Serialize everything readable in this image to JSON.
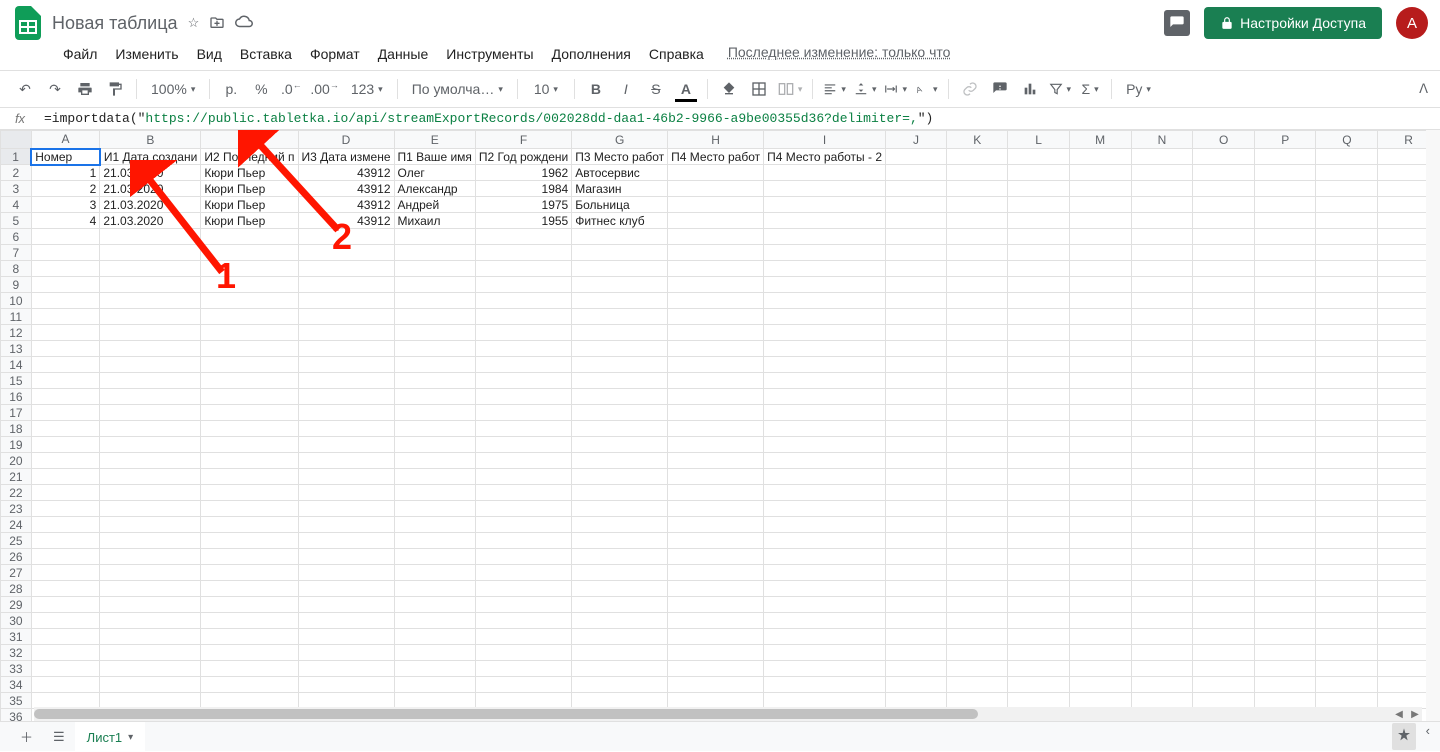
{
  "doc_title": "Новая таблица",
  "menu": [
    "Файл",
    "Изменить",
    "Вид",
    "Вставка",
    "Формат",
    "Данные",
    "Инструменты",
    "Дополнения",
    "Справка"
  ],
  "last_edit": "Последнее изменение: только что",
  "share_label": "Настройки Доступа",
  "avatar_letter": "А",
  "toolbar": {
    "zoom": "100%",
    "currency_p": "р.",
    "percent": "%",
    "dec_minus": ".0",
    "dec_plus": ".00",
    "more_fmt": "123",
    "font_name": "По умолча…",
    "font_size": "10"
  },
  "formula": {
    "prefix": "=importdata(\"",
    "url": "https://public.tabletka.io/api/streamExportRecords/002028dd-daa1-46b2-9966-a9be00355d36?delimiter=,",
    "suffix": "\")"
  },
  "columns": [
    "A",
    "B",
    "C",
    "D",
    "E",
    "F",
    "G",
    "H",
    "I",
    "J",
    "K",
    "L",
    "M",
    "N",
    "O",
    "P",
    "Q",
    "R"
  ],
  "headers_row": [
    "Номер",
    "И1 Дата создани",
    "И2 Последний п",
    "И3 Дата измене",
    "П1 Ваше имя",
    "П2 Год рождени",
    "П3 Место работ",
    "П4 Место работ",
    "П4 Место работы - 2"
  ],
  "data": [
    [
      "1",
      "21.03.2020",
      "Кюри Пьер",
      "43912",
      "Олег",
      "1962",
      "Автосервис",
      "",
      ""
    ],
    [
      "2",
      "21.03.2020",
      "Кюри Пьер",
      "43912",
      "Александр",
      "1984",
      "Магазин",
      "",
      ""
    ],
    [
      "3",
      "21.03.2020",
      "Кюри Пьер",
      "43912",
      "Андрей",
      "1975",
      "Больница",
      "",
      ""
    ],
    [
      "4",
      "21.03.2020",
      "Кюри Пьер",
      "43912",
      "Михаил",
      "1955",
      "Фитнес клуб",
      "",
      ""
    ]
  ],
  "numeric_cols": [
    0,
    3,
    5
  ],
  "sheet_tab": "Лист1",
  "annotations": {
    "one": "1",
    "two": "2"
  }
}
